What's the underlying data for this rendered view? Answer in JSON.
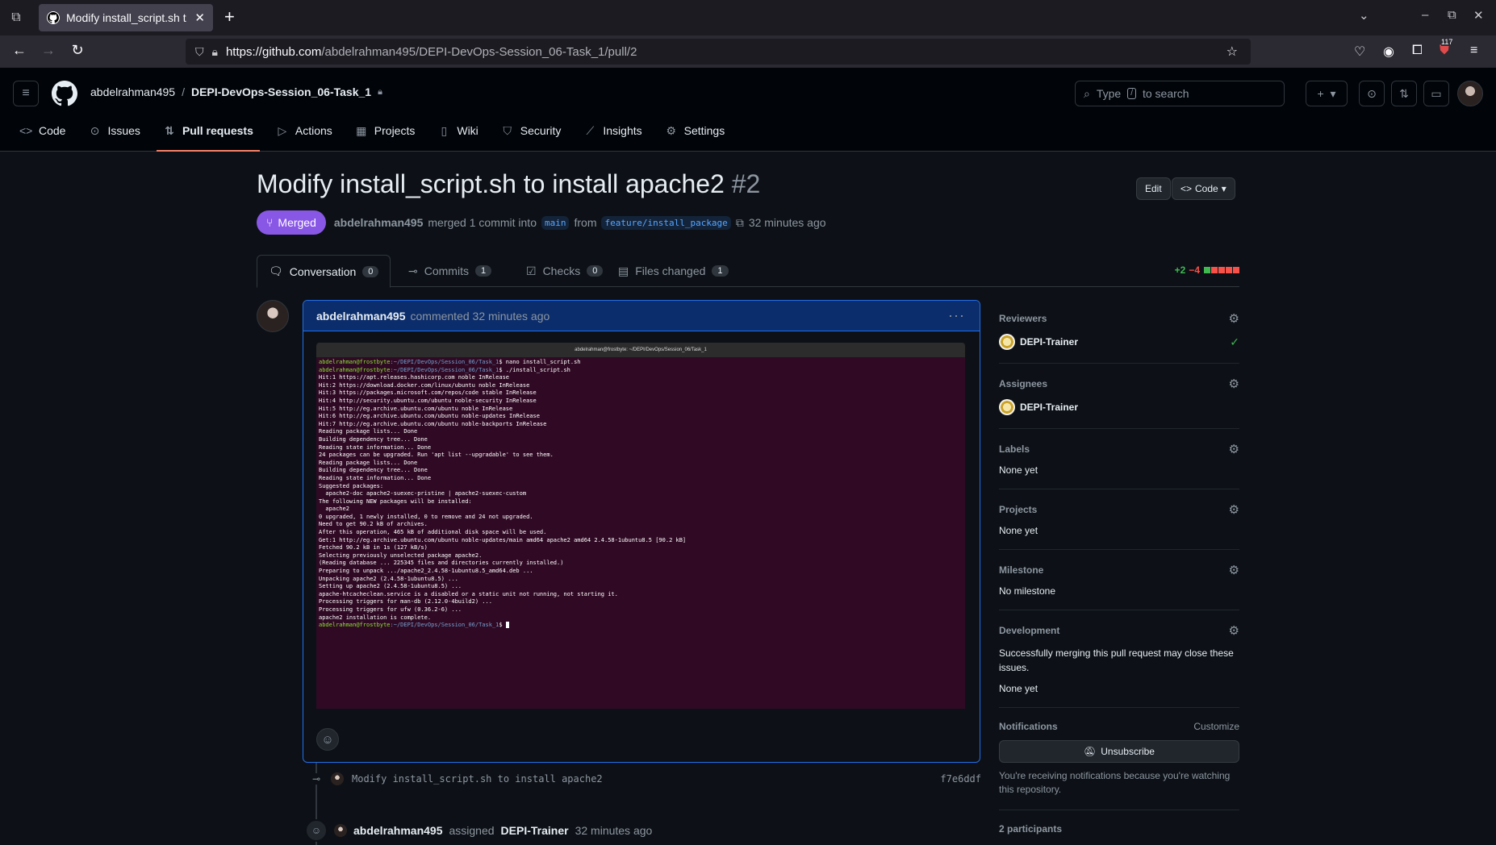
{
  "browser": {
    "tab_title": "Modify install_script.sh t",
    "url_host": "https://github.com",
    "url_path": "/abdelrahman495/DEPI-DevOps-Session_06-Task_1/pull/2",
    "extension_badge": "117"
  },
  "header": {
    "owner": "abdelrahman495",
    "separator": "/",
    "repo": "DEPI-DevOps-Session_06-Task_1",
    "search_prefix": "Type",
    "search_key": "/",
    "search_suffix": "to search"
  },
  "repo_nav": {
    "items": [
      {
        "label": "Code",
        "icon": "code-icon"
      },
      {
        "label": "Issues",
        "icon": "issue-icon"
      },
      {
        "label": "Pull requests",
        "icon": "pull-request-icon"
      },
      {
        "label": "Actions",
        "icon": "play-icon"
      },
      {
        "label": "Projects",
        "icon": "table-icon"
      },
      {
        "label": "Wiki",
        "icon": "book-icon"
      },
      {
        "label": "Security",
        "icon": "shield-icon"
      },
      {
        "label": "Insights",
        "icon": "graph-icon"
      },
      {
        "label": "Settings",
        "icon": "gear-icon"
      }
    ]
  },
  "pr": {
    "title": "Modify install_script.sh to install apache2",
    "number": "#2",
    "edit_label": "Edit",
    "code_label": "Code",
    "state": "Merged",
    "author": "abdelrahman495",
    "merged_text": "merged 1 commit into",
    "base": "main",
    "from_text": "from",
    "head": "feature/install_package",
    "time": "32 minutes ago"
  },
  "pr_tabs": [
    {
      "label": "Conversation",
      "count": "0"
    },
    {
      "label": "Commits",
      "count": "1"
    },
    {
      "label": "Checks",
      "count": "0"
    },
    {
      "label": "Files changed",
      "count": "1"
    }
  ],
  "diffstat": {
    "additions": "+2",
    "deletions": "−4"
  },
  "comment": {
    "author": "abdelrahman495",
    "action": "commented 32 minutes ago",
    "terminal_title": "abdelrahman@frostbyte: ~/DEPI/DevOps/Session_06/Task_1",
    "terminal_prompt_user": "abdelrahman@frostbyte",
    "terminal_prompt_dir": ":~/DEPI/DevOps/Session_06/Task_1",
    "terminal_lines": [
      "Hit:1 https://apt.releases.hashicorp.com noble InRelease",
      "Hit:2 https://download.docker.com/linux/ubuntu noble InRelease",
      "Hit:3 https://packages.microsoft.com/repos/code stable InRelease",
      "Hit:4 http://security.ubuntu.com/ubuntu noble-security InRelease",
      "Hit:5 http://eg.archive.ubuntu.com/ubuntu noble InRelease",
      "Hit:6 http://eg.archive.ubuntu.com/ubuntu noble-updates InRelease",
      "Hit:7 http://eg.archive.ubuntu.com/ubuntu noble-backports InRelease",
      "Reading package lists... Done",
      "Building dependency tree... Done",
      "Reading state information... Done",
      "24 packages can be upgraded. Run 'apt list --upgradable' to see them.",
      "Reading package lists... Done",
      "Building dependency tree... Done",
      "Reading state information... Done",
      "Suggested packages:",
      "  apache2-doc apache2-suexec-pristine | apache2-suexec-custom",
      "The following NEW packages will be installed:",
      "  apache2",
      "0 upgraded, 1 newly installed, 0 to remove and 24 not upgraded.",
      "Need to get 90.2 kB of archives.",
      "After this operation, 465 kB of additional disk space will be used.",
      "Get:1 http://eg.archive.ubuntu.com/ubuntu noble-updates/main amd64 apache2 amd64 2.4.58-1ubuntu8.5 [90.2 kB]",
      "Fetched 90.2 kB in 1s (127 kB/s)",
      "Selecting previously unselected package apache2.",
      "(Reading database ... 225345 files and directories currently installed.)",
      "Preparing to unpack .../apache2_2.4.58-1ubuntu8.5_amd64.deb ...",
      "Unpacking apache2 (2.4.58-1ubuntu8.5) ...",
      "Setting up apache2 (2.4.58-1ubuntu8.5) ...",
      "apache-htcacheclean.service is a disabled or a static unit not running, not starting it.",
      "Processing triggers for man-db (2.12.0-4build2) ...",
      "Processing triggers for ufw (0.36.2-6) ...",
      "apache2 installation is complete."
    ],
    "cmd1": "$ nano install_script.sh",
    "cmd2": "$ ./install_script.sh",
    "cmd_end": "$ "
  },
  "timeline": {
    "commit_message": "Modify install_script.sh to install apache2",
    "commit_sha": "f7e6ddf",
    "assign_actor": "abdelrahman495",
    "assign_verb": "assigned",
    "assignee": "DEPI-Trainer",
    "assign_time": "32 minutes ago"
  },
  "sidebar": {
    "reviewers_label": "Reviewers",
    "reviewer": "DEPI-Trainer",
    "assignees_label": "Assignees",
    "assignee": "DEPI-Trainer",
    "labels_label": "Labels",
    "labels_value": "None yet",
    "projects_label": "Projects",
    "projects_value": "None yet",
    "milestone_label": "Milestone",
    "milestone_value": "No milestone",
    "development_label": "Development",
    "development_desc": "Successfully merging this pull request may close these issues.",
    "development_value": "None yet",
    "notifications_label": "Notifications",
    "customize_label": "Customize",
    "unsubscribe_label": "Unsubscribe",
    "notifications_note": "You're receiving notifications because you're watching this repository.",
    "participants": "2 participants"
  },
  "colors": {
    "merged": "#8957e5",
    "accent_underline": "#f78166",
    "additions": "#3fb950",
    "deletions": "#f85149",
    "terminal_bg": "#300a24"
  }
}
